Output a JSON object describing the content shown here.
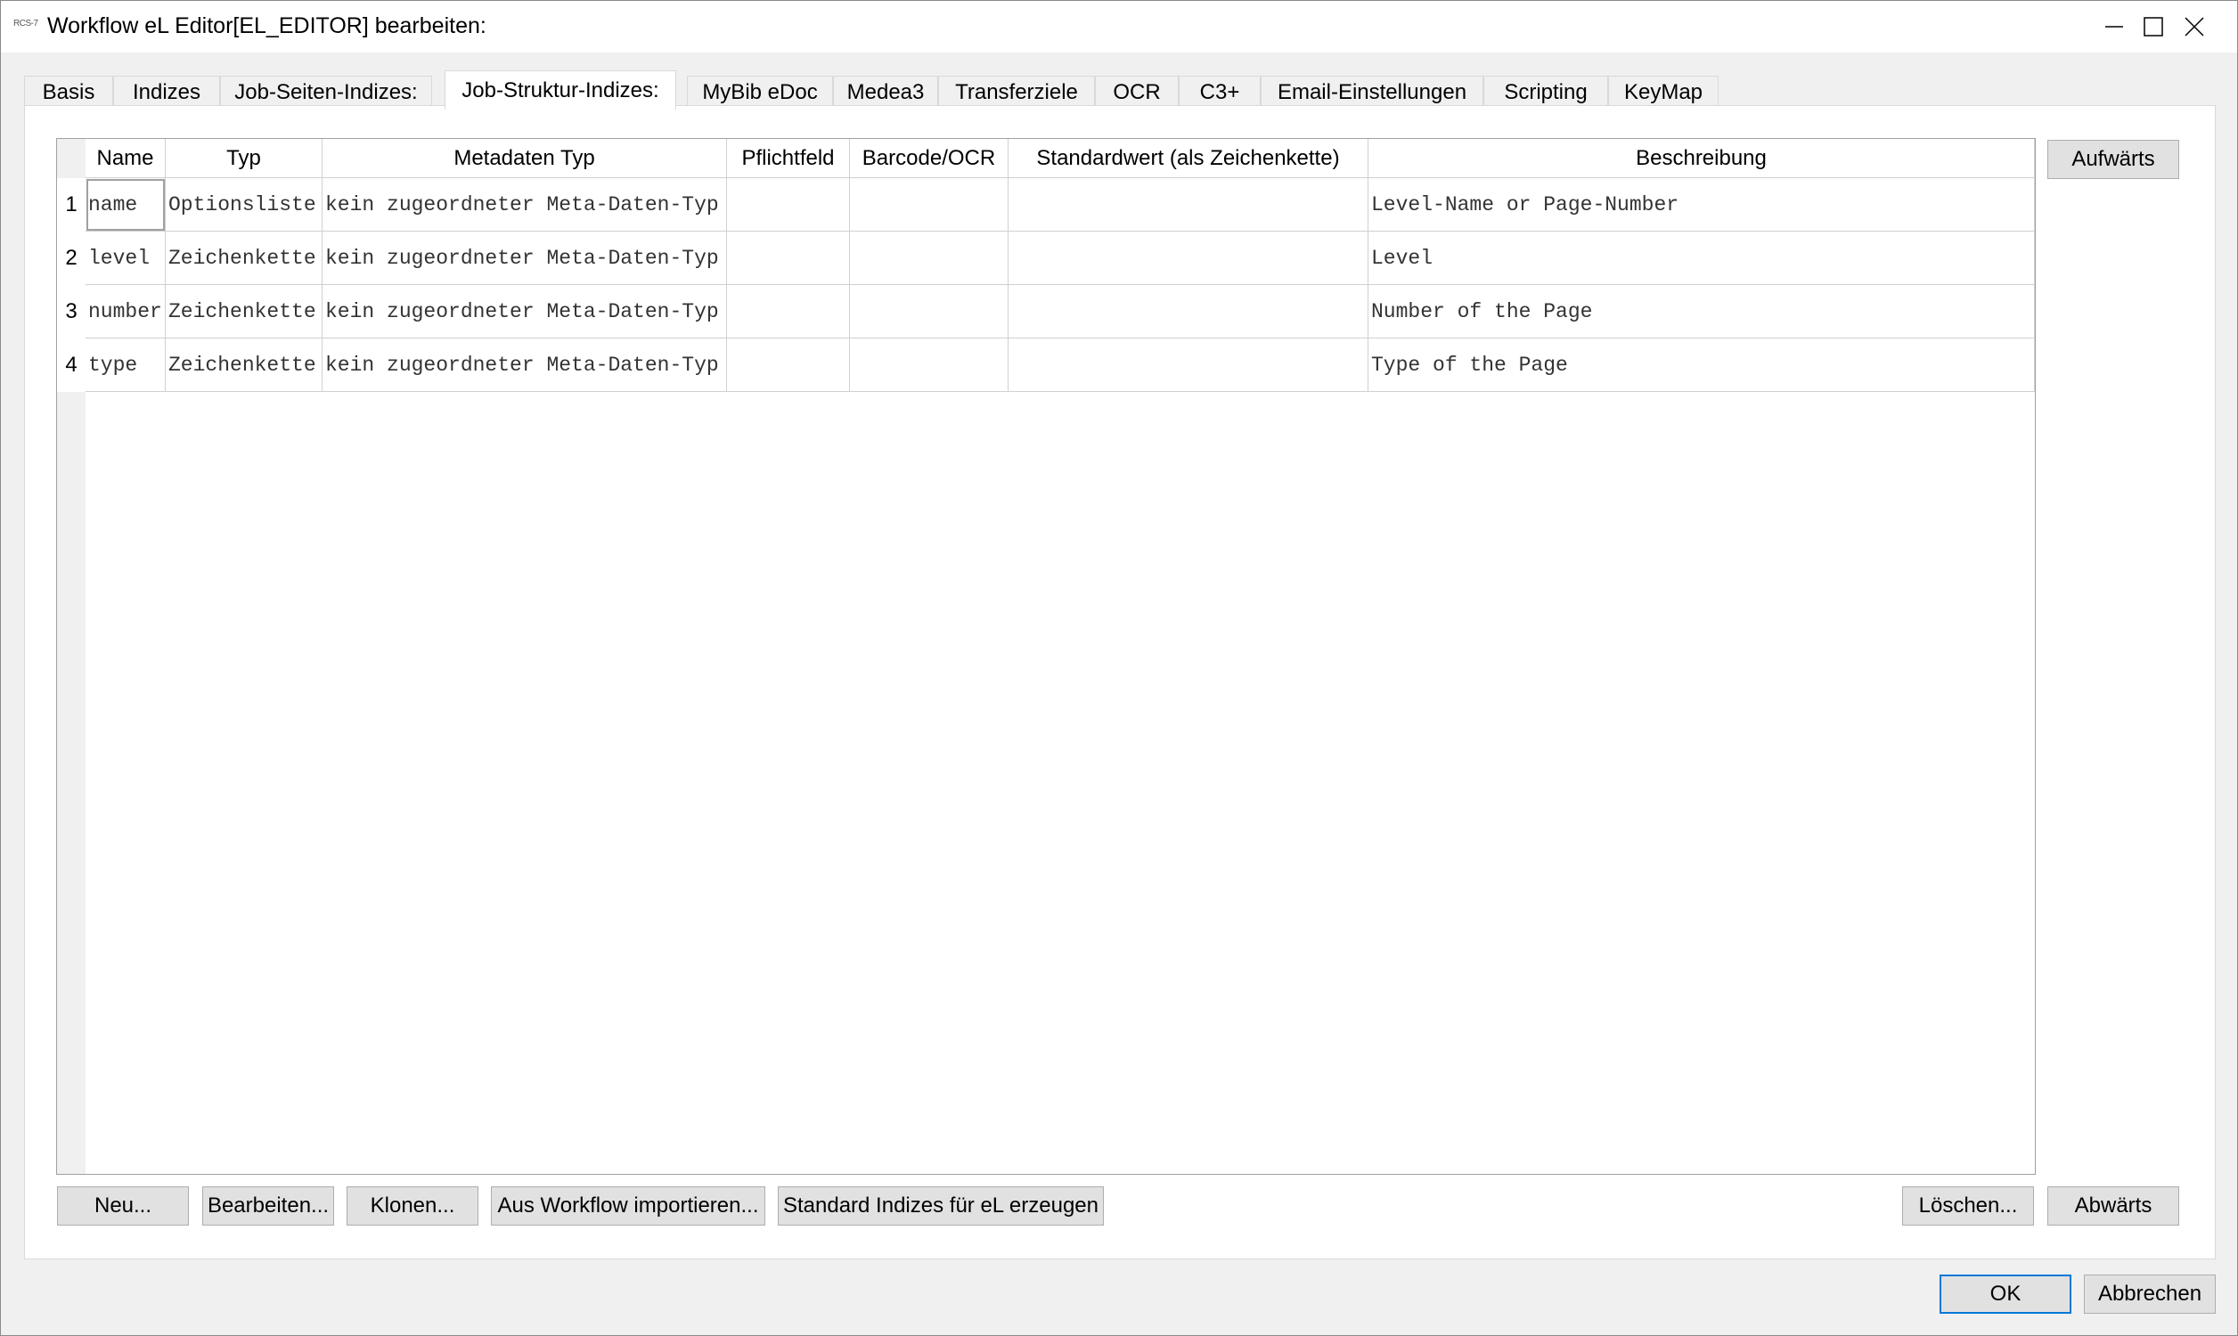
{
  "window": {
    "app_icon_text": "RCS-7",
    "title": "Workflow eL Editor[EL_EDITOR] bearbeiten:"
  },
  "tabs": [
    {
      "label": "Basis"
    },
    {
      "label": "Indizes"
    },
    {
      "label": "Job-Seiten-Indizes:"
    },
    {
      "label": "Job-Struktur-Indizes:",
      "active": true
    },
    {
      "label": "MyBib eDoc"
    },
    {
      "label": "Medea3"
    },
    {
      "label": "Transferziele"
    },
    {
      "label": "OCR"
    },
    {
      "label": "C3+"
    },
    {
      "label": "Email-Einstellungen"
    },
    {
      "label": "Scripting"
    },
    {
      "label": "KeyMap"
    }
  ],
  "table": {
    "columns": [
      "Name",
      "Typ",
      "Metadaten Typ",
      "Pflichtfeld",
      "Barcode/OCR",
      "Standardwert (als Zeichenkette)",
      "Beschreibung"
    ],
    "rows": [
      {
        "num": "1",
        "cells": [
          "name",
          "Optionsliste",
          "kein zugeordneter Meta-Daten-Typ",
          "",
          "",
          "",
          "Level-Name or Page-Number"
        ]
      },
      {
        "num": "2",
        "cells": [
          "level",
          "Zeichenkette",
          "kein zugeordneter Meta-Daten-Typ",
          "",
          "",
          "",
          "Level"
        ]
      },
      {
        "num": "3",
        "cells": [
          "number",
          "Zeichenkette",
          "kein zugeordneter Meta-Daten-Typ",
          "",
          "",
          "",
          "Number of the Page"
        ]
      },
      {
        "num": "4",
        "cells": [
          "type",
          "Zeichenkette",
          "kein zugeordneter Meta-Daten-Typ",
          "",
          "",
          "",
          "Type of the Page"
        ]
      }
    ]
  },
  "buttons": {
    "up": "Aufwärts",
    "down": "Abwärts",
    "new": "Neu...",
    "edit": "Bearbeiten...",
    "clone": "Klonen...",
    "import": "Aus Workflow importieren...",
    "standard": "Standard Indizes für eL erzeugen",
    "delete": "Löschen...",
    "ok": "OK",
    "cancel": "Abbrechen"
  },
  "colors": {
    "default_button_border": "#0078d7",
    "grid_border": "#a0a0a0"
  }
}
